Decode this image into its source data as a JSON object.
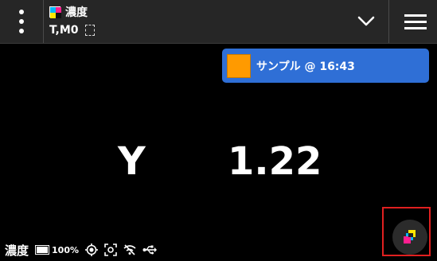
{
  "header": {
    "title": "濃度",
    "mode": "T,M0",
    "icons": {
      "menu_dots": "more-vert-icon",
      "cmyk": "cmyk-icon",
      "dashed": "dashed-square-icon",
      "dropdown": "chevron-down-icon",
      "hamburger": "menu-icon"
    }
  },
  "sample": {
    "label": "サンプル @ 16:43",
    "swatch_color": "#ff9a00",
    "background_color": "#2f6fd6"
  },
  "reading": {
    "channel": "Y",
    "value": "1.22"
  },
  "status": {
    "title": "濃度",
    "battery": "100%",
    "icons": [
      "battery-icon",
      "target-icon",
      "focus-icon",
      "wifi-off-icon",
      "usb-icon"
    ]
  },
  "fab": {
    "icon": "color-layers-icon",
    "highlight_color": "#e02020"
  },
  "colors": {
    "background": "#000000",
    "header": "#262626",
    "accent": "#2f6fd6"
  }
}
